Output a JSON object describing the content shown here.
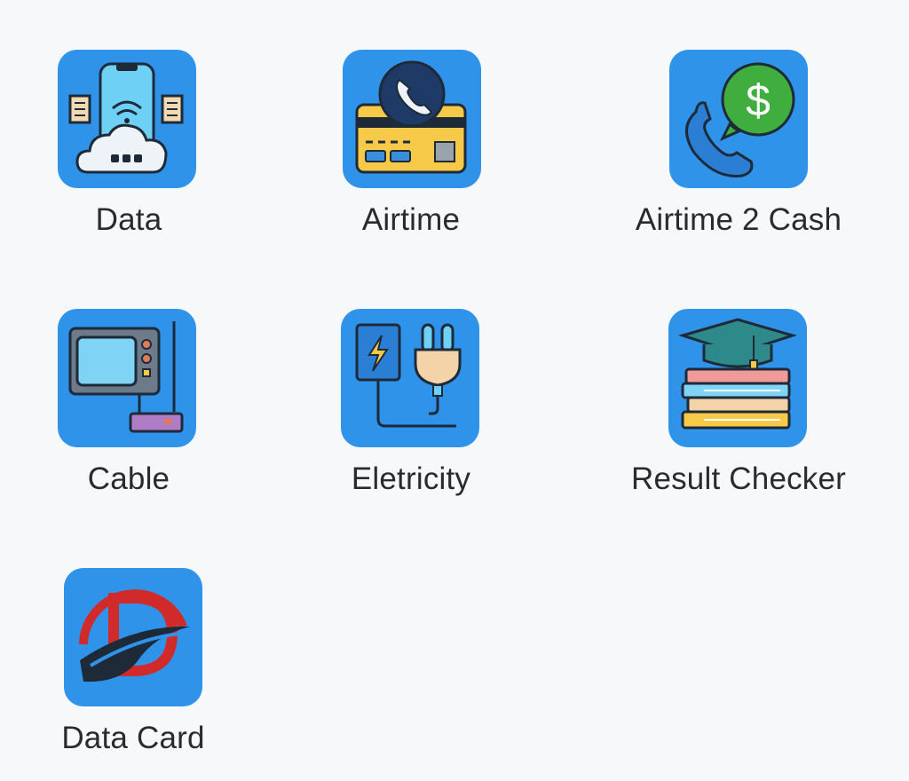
{
  "services": [
    {
      "id": "data",
      "label": "Data",
      "icon": "router-phone-icon"
    },
    {
      "id": "airtime",
      "label": "Airtime",
      "icon": "phone-card-icon"
    },
    {
      "id": "airtime2cash",
      "label": "Airtime 2 Cash",
      "icon": "phone-cash-icon"
    },
    {
      "id": "cable",
      "label": "Cable",
      "icon": "tv-icon"
    },
    {
      "id": "electricity",
      "label": "Eletricity",
      "icon": "plug-icon"
    },
    {
      "id": "result",
      "label": "Result Checker",
      "icon": "graduation-books-icon"
    },
    {
      "id": "datacard",
      "label": "Data Card",
      "icon": "data-card-logo-icon"
    }
  ],
  "colors": {
    "tile_bg": "#2f93ea",
    "page_bg": "#f7f8f9",
    "label": "#2b2b2b"
  }
}
